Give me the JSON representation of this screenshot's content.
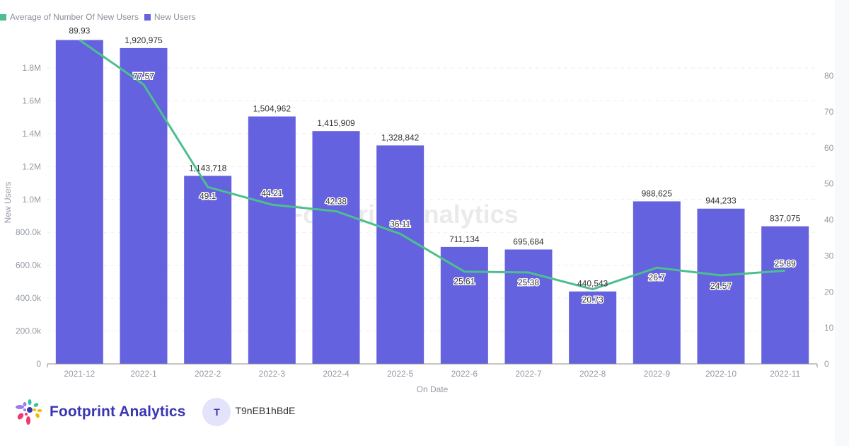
{
  "legend": {
    "items": [
      {
        "label": "Average of Number Of New Users",
        "color": "#4dbf8f"
      },
      {
        "label": "New Users",
        "color": "#6462de"
      }
    ]
  },
  "watermark": "Footprint Analytics",
  "footer": {
    "brand": "Footprint Analytics",
    "avatar_initial": "T",
    "user_id": "T9nEB1hBdE"
  },
  "chart_data": {
    "type": "bar",
    "title": "",
    "xlabel": "On Date",
    "ylabel": "New Users",
    "y2label": "",
    "categories": [
      "2021-12",
      "2022-1",
      "2022-2",
      "2022-3",
      "2022-4",
      "2022-5",
      "2022-6",
      "2022-7",
      "2022-8",
      "2022-9",
      "2022-10",
      "2022-11"
    ],
    "series": [
      {
        "name": "New Users",
        "type": "bar",
        "axis": "left",
        "color": "#6462de",
        "values": [
          1970000,
          1920975,
          1143718,
          1504962,
          1415909,
          1328842,
          711134,
          695684,
          440543,
          988625,
          944233,
          837075
        ],
        "labels": [
          null,
          "1,920,975",
          "1,143,718",
          "1,504,962",
          "1,415,909",
          "1,328,842",
          "711,134",
          "695,684",
          "440,543",
          "988,625",
          "944,233",
          "837,075"
        ]
      },
      {
        "name": "Average of Number Of New Users",
        "type": "line",
        "axis": "right",
        "color": "#4dbf8f",
        "values": [
          89.93,
          77.57,
          49.1,
          44.21,
          42.38,
          36.11,
          25.61,
          25.38,
          20.73,
          26.7,
          24.57,
          25.89
        ],
        "labels": [
          "89.93",
          "77.57",
          "49.1",
          "44.21",
          "42.38",
          "36.11",
          "25.61",
          "25.38",
          "20.73",
          "26.7",
          "24.57",
          "25.89"
        ]
      }
    ],
    "y_left": {
      "range": [
        0,
        1970000
      ],
      "ticks": [
        0,
        200000,
        400000,
        600000,
        800000,
        1000000,
        1200000,
        1400000,
        1600000,
        1800000
      ],
      "tick_labels": [
        "0",
        "200.0k",
        "400.0k",
        "600.0k",
        "800.0k",
        "1.0M",
        "1.2M",
        "1.4M",
        "1.6M",
        "1.8M"
      ]
    },
    "y_right": {
      "range": [
        0,
        90
      ],
      "ticks": [
        0,
        10,
        20,
        30,
        40,
        50,
        60,
        70,
        80
      ],
      "tick_labels": [
        "0",
        "10",
        "20",
        "30",
        "40",
        "50",
        "60",
        "70",
        "80"
      ]
    },
    "grid": true,
    "legend_position": "top-left"
  }
}
